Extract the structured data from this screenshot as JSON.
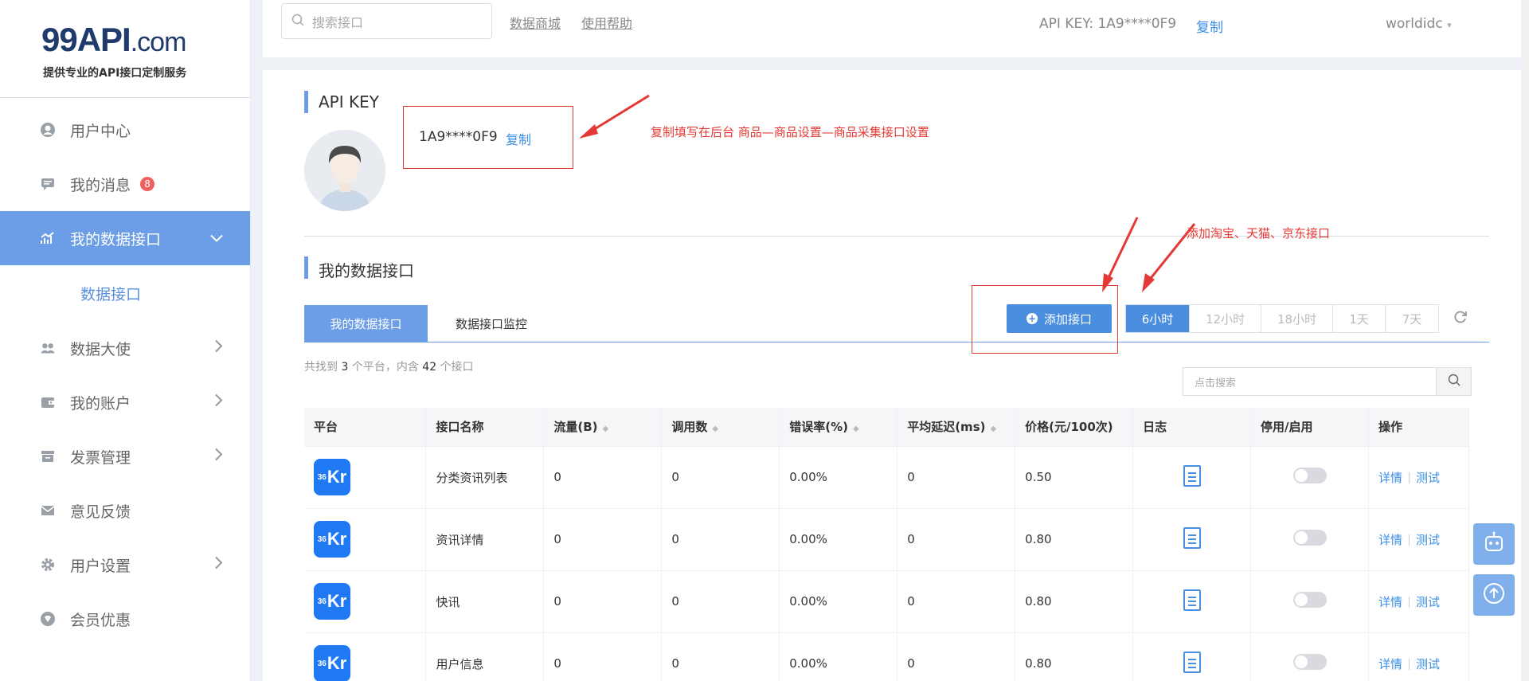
{
  "sidebar": {
    "logo_main": "99API",
    "logo_suffix": ".com",
    "logo_sub": "提供专业的API接口定制服务",
    "items": [
      {
        "label": "用户中心"
      },
      {
        "label": "我的消息",
        "badge": "8"
      },
      {
        "label": "我的数据接口"
      },
      {
        "label": "数据大使"
      },
      {
        "label": "我的账户"
      },
      {
        "label": "发票管理"
      },
      {
        "label": "意见反馈"
      },
      {
        "label": "用户设置"
      },
      {
        "label": "会员优惠"
      }
    ],
    "sub_item": "数据接口"
  },
  "topbar": {
    "search_placeholder": "搜索接口",
    "link_mall": "数据商城",
    "link_help": "使用帮助",
    "api_key_text": "API KEY:  1A9****0F9",
    "copy": "复制",
    "user": "worldidc",
    "user_caret": "▾"
  },
  "apikey_section": {
    "title": "API KEY",
    "key": "1A9****0F9",
    "copy": "复制",
    "note": "复制填写在后台 商品—商品设置—商品采集接口设置"
  },
  "interfaces_section": {
    "title": "我的数据接口",
    "note": "添加淘宝、天猫、京东接口",
    "tabs": [
      "我的数据接口",
      "数据接口监控"
    ],
    "add_button": "添加接口",
    "time_ranges": [
      "6小时",
      "12小时",
      "18小时",
      "1天",
      "7天"
    ],
    "count_prefix": "共找到",
    "platform_count": "3",
    "count_mid": "个平台，内含",
    "interface_count": "42",
    "count_suffix": "个接口",
    "search_placeholder": "点击搜索"
  },
  "table": {
    "headers": [
      "平台",
      "接口名称",
      "流量(B)",
      "调用数",
      "错误率(%)",
      "平均延迟(ms)",
      "价格(元/100次)",
      "日志",
      "停用/启用",
      "操作"
    ],
    "rows": [
      {
        "platform": "36Kr",
        "name": "分类资讯列表",
        "traffic": "0",
        "calls": "0",
        "error_rate": "0.00%",
        "latency": "0",
        "price": "0.50"
      },
      {
        "platform": "36Kr",
        "name": "资讯详情",
        "traffic": "0",
        "calls": "0",
        "error_rate": "0.00%",
        "latency": "0",
        "price": "0.80"
      },
      {
        "platform": "36Kr",
        "name": "快讯",
        "traffic": "0",
        "calls": "0",
        "error_rate": "0.00%",
        "latency": "0",
        "price": "0.80"
      },
      {
        "platform": "36Kr",
        "name": "用户信息",
        "traffic": "0",
        "calls": "0",
        "error_rate": "0.00%",
        "latency": "0",
        "price": "0.80"
      }
    ],
    "op_detail": "详情",
    "op_test": "测试"
  },
  "colors": {
    "accent": "#6b9ee6",
    "primary_button": "#4a8ee0",
    "annotation_red": "#e53935",
    "platform_logo": "#1f79f2"
  }
}
